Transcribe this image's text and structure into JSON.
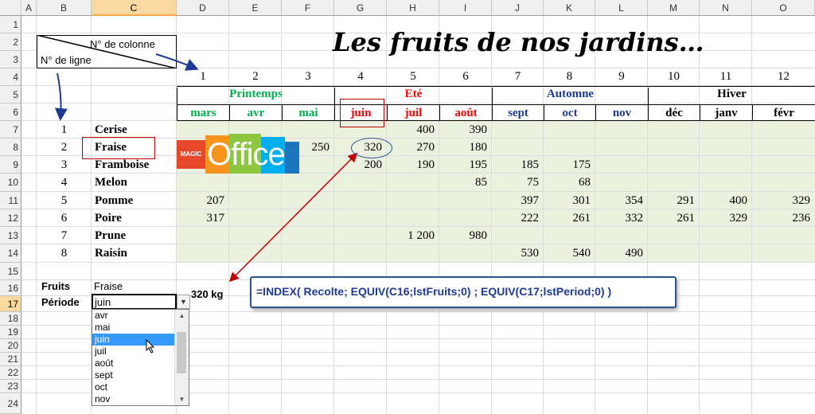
{
  "columns": [
    "A",
    "B",
    "C",
    "D",
    "E",
    "F",
    "G",
    "H",
    "I",
    "J",
    "K",
    "L",
    "M",
    "N",
    "O"
  ],
  "rows": [
    "1",
    "2",
    "3",
    "4",
    "5",
    "6",
    "7",
    "8",
    "9",
    "10",
    "11",
    "12",
    "13",
    "14",
    "15",
    "16",
    "17",
    "18",
    "19",
    "20",
    "21",
    "22",
    "23",
    "24"
  ],
  "title": "Les fruits de nos jardins…",
  "header_box": {
    "col_label": "N° de colonne",
    "row_label": "N° de ligne"
  },
  "col_numbers": [
    "1",
    "2",
    "3",
    "4",
    "5",
    "6",
    "7",
    "8",
    "9",
    "10",
    "11",
    "12"
  ],
  "seasons": [
    "Printemps",
    "Eté",
    "Automne",
    "Hiver"
  ],
  "season_colors": [
    "#00b050",
    "#ff0000",
    "#1f3a93",
    "#000000"
  ],
  "months": [
    "mars",
    "avr",
    "mai",
    "juin",
    "juil",
    "août",
    "sept",
    "oct",
    "nov",
    "déc",
    "janv",
    "févr"
  ],
  "fruits": [
    {
      "n": "1",
      "name": "Cerise"
    },
    {
      "n": "2",
      "name": "Fraise"
    },
    {
      "n": "3",
      "name": "Framboise"
    },
    {
      "n": "4",
      "name": "Melon"
    },
    {
      "n": "5",
      "name": "Pomme"
    },
    {
      "n": "6",
      "name": "Poire"
    },
    {
      "n": "7",
      "name": "Prune"
    },
    {
      "n": "8",
      "name": "Raisin"
    }
  ],
  "values": {
    "r0": {
      "5": "400",
      "6": "390"
    },
    "r1": {
      "3": "250",
      "4": "320",
      "5": "270",
      "6": "180"
    },
    "r2": {
      "4": "200",
      "5": "190",
      "6": "195",
      "7": "185",
      "8": "175"
    },
    "r3": {
      "6": "85",
      "7": "75",
      "8": "68"
    },
    "r4": {
      "1": "207",
      "7": "397",
      "8": "301",
      "9": "354",
      "10": "291",
      "11": "400",
      "12": "329"
    },
    "r5": {
      "1": "317",
      "7": "222",
      "8": "261",
      "9": "332",
      "10": "261",
      "11": "329",
      "12": "236"
    },
    "r6": {
      "5": "1 200",
      "6": "980"
    },
    "r7": {
      "7": "530",
      "8": "540",
      "9": "490"
    }
  },
  "logo": {
    "magic": "MAGIC",
    "text": "Office"
  },
  "lookup": {
    "fruits_label": "Fruits",
    "fruits_value": "Fraise",
    "period_label": "Période",
    "period_value": "juin",
    "result": "320 kg"
  },
  "formula": "=INDEX( Recolte; EQUIV(C16;lstFruits;0) ; EQUIV(C17;lstPeriod;0) )",
  "dropdown": {
    "items": [
      "avr",
      "mai",
      "juin",
      "juil",
      "août",
      "sept",
      "oct",
      "nov"
    ],
    "selected": "juin"
  }
}
